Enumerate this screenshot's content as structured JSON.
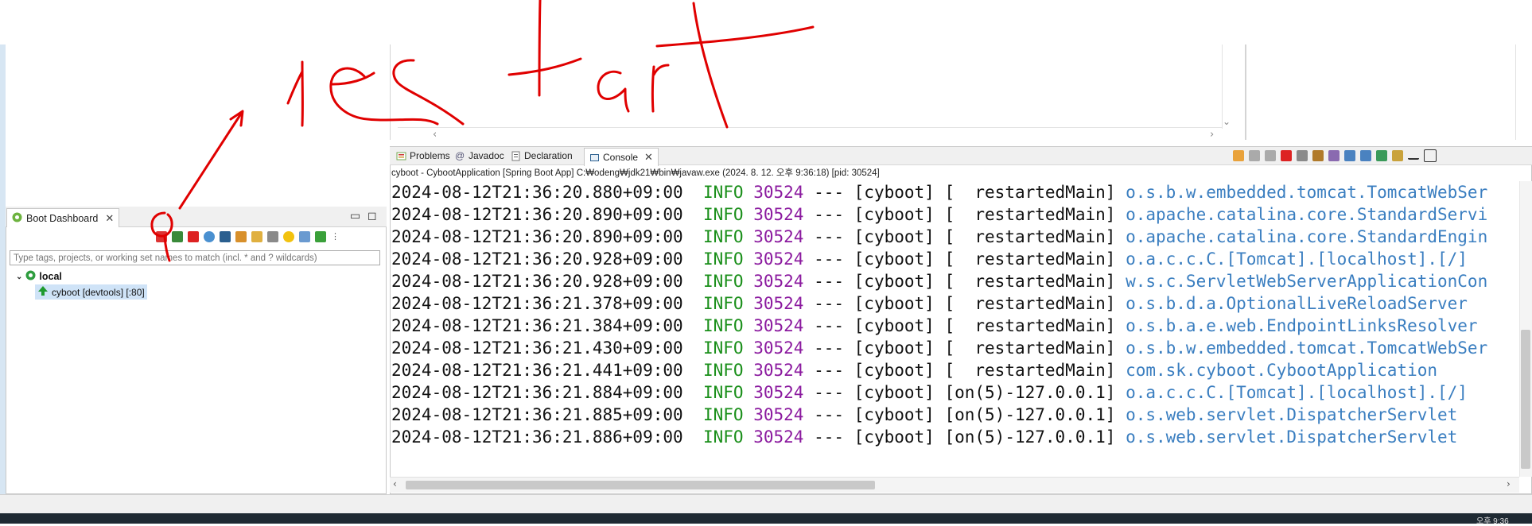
{
  "tabs": [
    {
      "label": "Problems",
      "icon": "problems-icon"
    },
    {
      "label": "Javadoc",
      "icon": "javadoc-icon"
    },
    {
      "label": "Declaration",
      "icon": "declaration-icon"
    },
    {
      "label": "Console",
      "icon": "console-icon",
      "active": true
    }
  ],
  "console": {
    "description": "cyboot - CybootApplication [Spring Boot App] C:₩odeng₩jdk21₩bin₩javaw.exe  (2024. 8. 12. 오후 9:36:18) [pid: 30524]",
    "lines": [
      {
        "ts": "2024-08-12T21:36:20.880+09:00",
        "level": "INFO",
        "pid": "30524",
        "sep": "---",
        "app": "[cyboot]",
        "thread": "[  restartedMain]",
        "logger": "o.s.b.w.embedded.tomcat.TomcatWebSer"
      },
      {
        "ts": "2024-08-12T21:36:20.890+09:00",
        "level": "INFO",
        "pid": "30524",
        "sep": "---",
        "app": "[cyboot]",
        "thread": "[  restartedMain]",
        "logger": "o.apache.catalina.core.StandardServi"
      },
      {
        "ts": "2024-08-12T21:36:20.890+09:00",
        "level": "INFO",
        "pid": "30524",
        "sep": "---",
        "app": "[cyboot]",
        "thread": "[  restartedMain]",
        "logger": "o.apache.catalina.core.StandardEngin"
      },
      {
        "ts": "2024-08-12T21:36:20.928+09:00",
        "level": "INFO",
        "pid": "30524",
        "sep": "---",
        "app": "[cyboot]",
        "thread": "[  restartedMain]",
        "logger": "o.a.c.c.C.[Tomcat].[localhost].[/]"
      },
      {
        "ts": "2024-08-12T21:36:20.928+09:00",
        "level": "INFO",
        "pid": "30524",
        "sep": "---",
        "app": "[cyboot]",
        "thread": "[  restartedMain]",
        "logger": "w.s.c.ServletWebServerApplicationCon"
      },
      {
        "ts": "2024-08-12T21:36:21.378+09:00",
        "level": "INFO",
        "pid": "30524",
        "sep": "---",
        "app": "[cyboot]",
        "thread": "[  restartedMain]",
        "logger": "o.s.b.d.a.OptionalLiveReloadServer"
      },
      {
        "ts": "2024-08-12T21:36:21.384+09:00",
        "level": "INFO",
        "pid": "30524",
        "sep": "---",
        "app": "[cyboot]",
        "thread": "[  restartedMain]",
        "logger": "o.s.b.a.e.web.EndpointLinksResolver"
      },
      {
        "ts": "2024-08-12T21:36:21.430+09:00",
        "level": "INFO",
        "pid": "30524",
        "sep": "---",
        "app": "[cyboot]",
        "thread": "[  restartedMain]",
        "logger": "o.s.b.w.embedded.tomcat.TomcatWebSer"
      },
      {
        "ts": "2024-08-12T21:36:21.441+09:00",
        "level": "INFO",
        "pid": "30524",
        "sep": "---",
        "app": "[cyboot]",
        "thread": "[  restartedMain]",
        "logger": "com.sk.cyboot.CybootApplication"
      },
      {
        "ts": "2024-08-12T21:36:21.884+09:00",
        "level": "INFO",
        "pid": "30524",
        "sep": "---",
        "app": "[cyboot]",
        "thread": "[on(5)-127.0.0.1]",
        "logger": "o.a.c.c.C.[Tomcat].[localhost].[/]"
      },
      {
        "ts": "2024-08-12T21:36:21.885+09:00",
        "level": "INFO",
        "pid": "30524",
        "sep": "---",
        "app": "[cyboot]",
        "thread": "[on(5)-127.0.0.1]",
        "logger": "o.s.web.servlet.DispatcherServlet"
      },
      {
        "ts": "2024-08-12T21:36:21.886+09:00",
        "level": "INFO",
        "pid": "30524",
        "sep": "---",
        "app": "[cyboot]",
        "thread": "[on(5)-127.0.0.1]",
        "logger": "o.s.web.servlet.DispatcherServlet"
      }
    ]
  },
  "boot_dashboard": {
    "tab_label": "Boot Dashboard",
    "filter_placeholder": "Type tags, projects, or working set names to match (incl. * and ? wildcards)",
    "tree": {
      "group": "local",
      "app": "cyboot [devtools] [:80]"
    }
  },
  "taskbar": {
    "clock": "오후 9:36"
  },
  "colors": {
    "level_info": "#1a8f1a",
    "pid": "#8b1a9f",
    "logger": "#3a7ec0",
    "annotation": "#e00000"
  }
}
